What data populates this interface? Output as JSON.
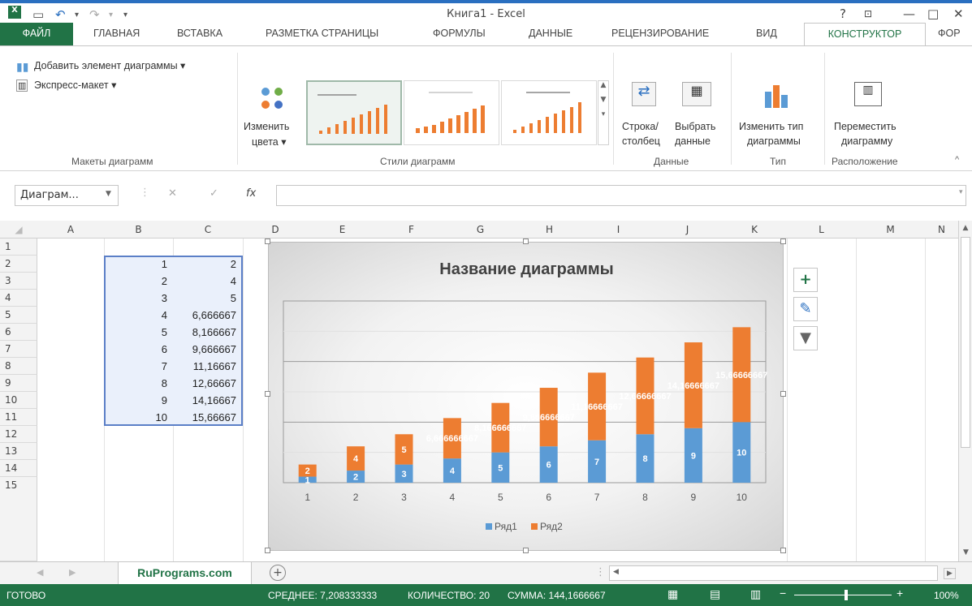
{
  "window": {
    "title": "Книга1 - Excel",
    "help": "?",
    "minimize": "—",
    "maximize": "□",
    "close": "✕"
  },
  "tabs": [
    {
      "label": "ФАЙЛ"
    },
    {
      "label": "ГЛАВНАЯ"
    },
    {
      "label": "ВСТАВКА"
    },
    {
      "label": "РАЗМЕТКА СТРАНИЦЫ"
    },
    {
      "label": "ФОРМУЛЫ"
    },
    {
      "label": "ДАННЫЕ"
    },
    {
      "label": "РЕЦЕНЗИРОВАНИЕ"
    },
    {
      "label": "ВИД"
    },
    {
      "label": "КОНСТРУКТОР"
    },
    {
      "label": "ФОР"
    }
  ],
  "ribbon": {
    "add_element": "Добавить элемент диаграммы ▾",
    "express_layout": "Экспресс-макет ▾",
    "group_layouts": "Макеты диаграмм",
    "change_colors_1": "Изменить",
    "change_colors_2": "цвета ▾",
    "group_styles": "Стили диаграмм",
    "row_col_1": "Строка/",
    "row_col_2": "столбец",
    "select_data_1": "Выбрать",
    "select_data_2": "данные",
    "group_data": "Данные",
    "change_type_1": "Изменить тип",
    "change_type_2": "диаграммы",
    "group_type": "Тип",
    "move_chart_1": "Переместить",
    "move_chart_2": "диаграмму",
    "group_location": "Расположение"
  },
  "formula_bar": {
    "name_box": "Диаграм...",
    "fx": "fx",
    "value": ""
  },
  "columns": [
    "A",
    "B",
    "C",
    "D",
    "E",
    "F",
    "G",
    "H",
    "I",
    "J",
    "K",
    "L",
    "M",
    "N"
  ],
  "rows": [
    "1",
    "2",
    "3",
    "4",
    "5",
    "6",
    "7",
    "8",
    "9",
    "10",
    "11",
    "12",
    "13",
    "14",
    "15"
  ],
  "cells": {
    "B": [
      "1",
      "2",
      "3",
      "4",
      "5",
      "6",
      "7",
      "8",
      "9",
      "10"
    ],
    "C": [
      "2",
      "4",
      "5",
      "6,666667",
      "8,166667",
      "9,666667",
      "11,16667",
      "12,66667",
      "14,16667",
      "15,66667"
    ]
  },
  "chart_data": {
    "type": "bar",
    "stacked": true,
    "title": "Название диаграммы",
    "categories": [
      "1",
      "2",
      "3",
      "4",
      "5",
      "6",
      "7",
      "8",
      "9",
      "10"
    ],
    "series": [
      {
        "name": "Ряд1",
        "color": "#5b9bd5",
        "values": [
          1,
          2,
          3,
          4,
          5,
          6,
          7,
          8,
          9,
          10
        ],
        "labels": [
          "1",
          "2",
          "3",
          "4",
          "5",
          "6",
          "7",
          "8",
          "9",
          "10"
        ]
      },
      {
        "name": "Ряд2",
        "color": "#ed7d31",
        "values": [
          2,
          4,
          5,
          6.666667,
          8.166667,
          9.666667,
          11.16667,
          12.66667,
          14.16667,
          15.66667
        ],
        "labels": [
          "2",
          "4",
          "5",
          "6,666666667",
          "8,166666667",
          "9,666666667",
          "11,16666667",
          "12,66666667",
          "14,16666667",
          "15,66666667"
        ]
      }
    ],
    "ylim": [
      0,
      30
    ],
    "grid": true,
    "legend": "bottom"
  },
  "sheet": {
    "tab": "RuPrograms.com",
    "add": "+"
  },
  "status": {
    "ready": "ГОТОВО",
    "average": "СРЕДНЕЕ: 7,208333333",
    "count": "КОЛИЧЕСТВО: 20",
    "sum": "СУММА: 144,1666667",
    "zoom": "100%"
  },
  "colors": {
    "accent": "#217346",
    "series1": "#5b9bd5",
    "series2": "#ed7d31"
  }
}
